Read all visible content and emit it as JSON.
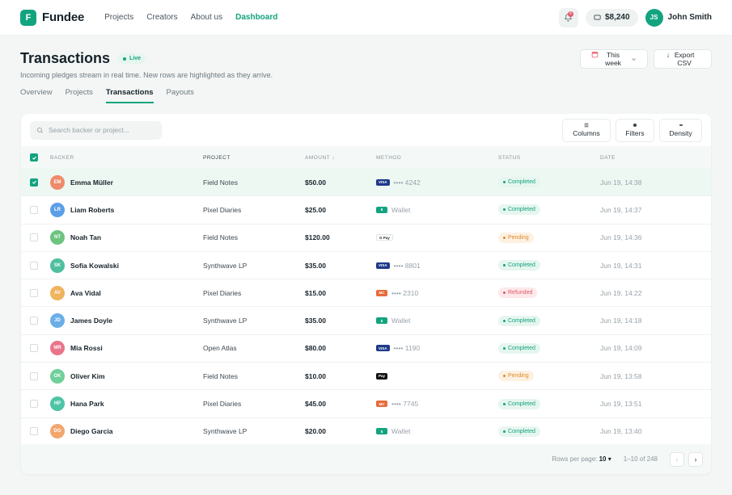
{
  "brand": {
    "logo_letter": "F",
    "name": "Fundee",
    "accent": "#12a37f"
  },
  "nav": [
    {
      "label": "Projects",
      "active": false
    },
    {
      "label": "Creators",
      "active": false
    },
    {
      "label": "About us",
      "active": false
    },
    {
      "label": "Dashboard",
      "active": true
    }
  ],
  "header": {
    "notification_count": "6",
    "balance": "$8,240",
    "user_initials": "JS",
    "user_name": "John Smith"
  },
  "page": {
    "title": "Transactions",
    "live_label": "Live",
    "subtitle": "Incoming pledges stream in real time. New rows are highlighted as they arrive.",
    "range_button": "This week",
    "export_button": "Export CSV"
  },
  "tabs": [
    {
      "label": "Overview",
      "active": false
    },
    {
      "label": "Projects",
      "active": false
    },
    {
      "label": "Transactions",
      "active": true
    },
    {
      "label": "Payouts",
      "active": false
    }
  ],
  "toolbar": {
    "search_placeholder": "Search backer or project...",
    "columns": "Columns",
    "filters": "Filters",
    "density": "Density"
  },
  "table": {
    "headers": {
      "backer": "BACKER",
      "project": "PROJECT",
      "amount": "AMOUNT ↓",
      "method": "METHOD",
      "status": "STATUS",
      "date": "DATE"
    },
    "rows": [
      {
        "checked": true,
        "highlight": true,
        "initials": "EM",
        "avatar_color": "#ef8a6a",
        "name": "Emma Müller",
        "project": "Field Notes",
        "amount": "$50.00",
        "method_badge": "VISA",
        "method_type": "visa",
        "method_text": "•••• 4242",
        "status": "Completed",
        "status_kind": "completed",
        "date": "Jun 19, 14:38"
      },
      {
        "checked": false,
        "highlight": false,
        "initials": "LR",
        "avatar_color": "#5b9ee8",
        "name": "Liam Roberts",
        "project": "Pixel Diaries",
        "amount": "$25.00",
        "method_badge": "$",
        "method_type": "wallet",
        "method_text": "Wallet",
        "status": "Completed",
        "status_kind": "completed",
        "date": "Jun 19, 14:37"
      },
      {
        "checked": false,
        "highlight": false,
        "initials": "NT",
        "avatar_color": "#6cc47f",
        "name": "Noah Tan",
        "project": "Field Notes",
        "amount": "$120.00",
        "method_badge": "G Pay",
        "method_type": "gpay",
        "method_text": "",
        "status": "Pending",
        "status_kind": "pending",
        "date": "Jun 19, 14:36"
      },
      {
        "checked": false,
        "highlight": false,
        "initials": "SK",
        "avatar_color": "#4fbf9f",
        "name": "Sofia Kowalski",
        "project": "Synthwave LP",
        "amount": "$35.00",
        "method_badge": "VISA",
        "method_type": "visa",
        "method_text": "•••• 8801",
        "status": "Completed",
        "status_kind": "completed",
        "date": "Jun 19, 14:31"
      },
      {
        "checked": false,
        "highlight": false,
        "initials": "AV",
        "avatar_color": "#f0b35e",
        "name": "Ava Vidal",
        "project": "Pixel Diaries",
        "amount": "$15.00",
        "method_badge": "MC",
        "method_type": "mc",
        "method_text": "•••• 2310",
        "status": "Refunded",
        "status_kind": "refunded",
        "date": "Jun 19, 14:22"
      },
      {
        "checked": false,
        "highlight": false,
        "initials": "JD",
        "avatar_color": "#6aaee8",
        "name": "James Doyle",
        "project": "Synthwave LP",
        "amount": "$35.00",
        "method_badge": "$",
        "method_type": "wallet",
        "method_text": "Wallet",
        "status": "Completed",
        "status_kind": "completed",
        "date": "Jun 19, 14:18"
      },
      {
        "checked": false,
        "highlight": false,
        "initials": "MR",
        "avatar_color": "#e8748a",
        "name": "Mia Rossi",
        "project": "Open Atlas",
        "amount": "$80.00",
        "method_badge": "VISA",
        "method_type": "visa",
        "method_text": "•••• 1190",
        "status": "Completed",
        "status_kind": "completed",
        "date": "Jun 19, 14:09"
      },
      {
        "checked": false,
        "highlight": false,
        "initials": "OK",
        "avatar_color": "#6fcf9a",
        "name": "Oliver Kim",
        "project": "Field Notes",
        "amount": "$10.00",
        "method_badge": "Pay",
        "method_type": "applepay",
        "method_text": "",
        "status": "Pending",
        "status_kind": "pending",
        "date": "Jun 19, 13:58"
      },
      {
        "checked": false,
        "highlight": false,
        "initials": "HP",
        "avatar_color": "#4fc4a6",
        "name": "Hana Park",
        "project": "Pixel Diaries",
        "amount": "$45.00",
        "method_badge": "MC",
        "method_type": "mc",
        "method_text": "•••• 7745",
        "status": "Completed",
        "status_kind": "completed",
        "date": "Jun 19, 13:51"
      },
      {
        "checked": false,
        "highlight": false,
        "initials": "DG",
        "avatar_color": "#f2a66e",
        "name": "Diego Garcia",
        "project": "Synthwave LP",
        "amount": "$20.00",
        "method_badge": "$",
        "method_type": "wallet",
        "method_text": "Wallet",
        "status": "Completed",
        "status_kind": "completed",
        "date": "Jun 19, 13:40"
      }
    ]
  },
  "footer": {
    "rows_per_page_label": "Rows per page:",
    "rows_per_page_value": "10 ▾",
    "range": "1–10 of 248",
    "prev": "‹",
    "next": "›"
  }
}
